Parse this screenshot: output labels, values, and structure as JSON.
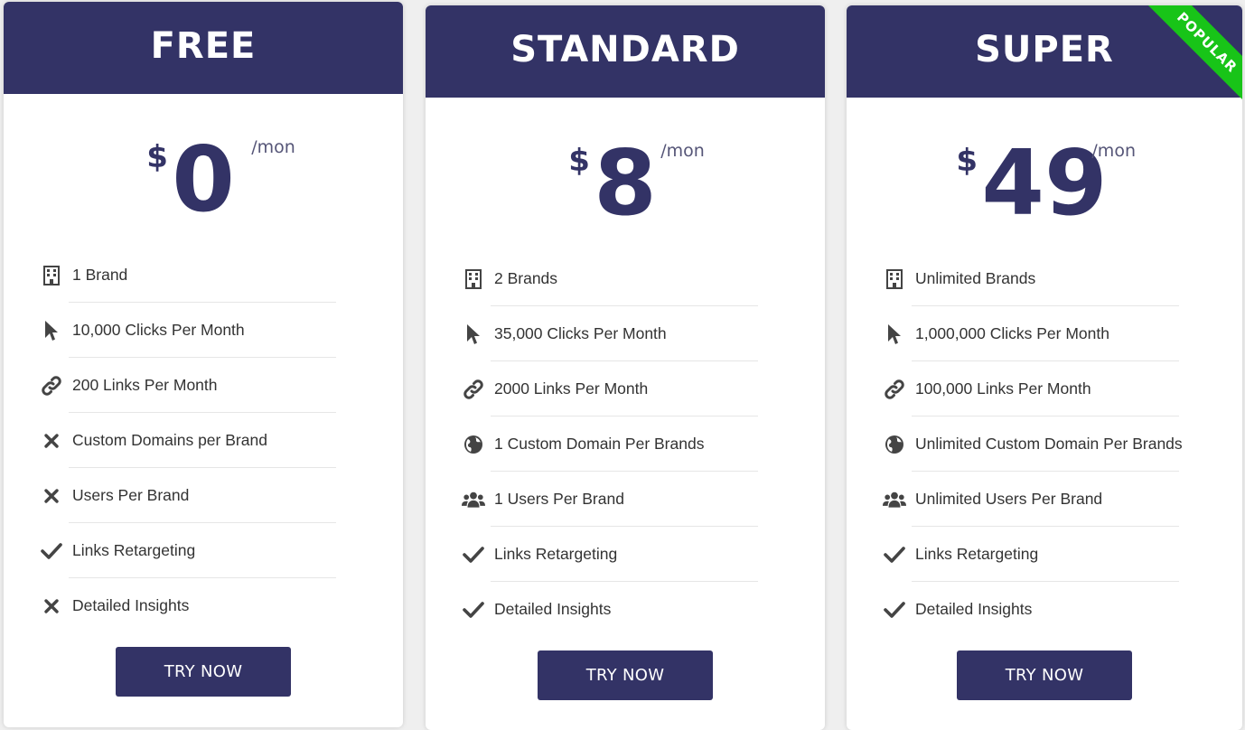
{
  "plans": [
    {
      "name": "FREE",
      "currency": "$",
      "amount": "0",
      "per": "/mon",
      "cta": "TRY NOW",
      "features": [
        {
          "icon": "building-icon",
          "label": "1 Brand"
        },
        {
          "icon": "cursor-icon",
          "label": "10,000 Clicks Per Month"
        },
        {
          "icon": "link-icon",
          "label": "200 Links Per Month"
        },
        {
          "icon": "cross-icon",
          "label": "Custom Domains per Brand"
        },
        {
          "icon": "cross-icon",
          "label": "Users Per Brand"
        },
        {
          "icon": "check-icon",
          "label": "Links Retargeting"
        },
        {
          "icon": "cross-icon",
          "label": "Detailed Insights"
        }
      ]
    },
    {
      "name": "STANDARD",
      "currency": "$",
      "amount": "8",
      "per": "/mon",
      "cta": "TRY NOW",
      "features": [
        {
          "icon": "building-icon",
          "label": "2 Brands"
        },
        {
          "icon": "cursor-icon",
          "label": "35,000 Clicks Per Month"
        },
        {
          "icon": "link-icon",
          "label": "2000 Links Per Month"
        },
        {
          "icon": "globe-icon",
          "label": "1 Custom Domain Per Brands"
        },
        {
          "icon": "users-icon",
          "label": "1 Users Per Brand"
        },
        {
          "icon": "check-icon",
          "label": "Links Retargeting"
        },
        {
          "icon": "check-icon",
          "label": "Detailed Insights"
        }
      ]
    },
    {
      "name": "SUPER",
      "currency": "$",
      "amount": "49",
      "per": "/mon",
      "cta": "TRY NOW",
      "badge": "POPULAR",
      "features": [
        {
          "icon": "building-icon",
          "label": "Unlimited Brands"
        },
        {
          "icon": "cursor-icon",
          "label": "1,000,000 Clicks Per Month"
        },
        {
          "icon": "link-icon",
          "label": "100,000 Links Per Month"
        },
        {
          "icon": "globe-icon",
          "label": "Unlimited Custom Domain Per Brands"
        },
        {
          "icon": "users-icon",
          "label": "Unlimited Users Per Brand"
        },
        {
          "icon": "check-icon",
          "label": "Links Retargeting"
        },
        {
          "icon": "check-icon",
          "label": "Detailed Insights"
        }
      ]
    }
  ],
  "colors": {
    "header": "#333366",
    "price": "#333366",
    "badge": "#18c418"
  }
}
